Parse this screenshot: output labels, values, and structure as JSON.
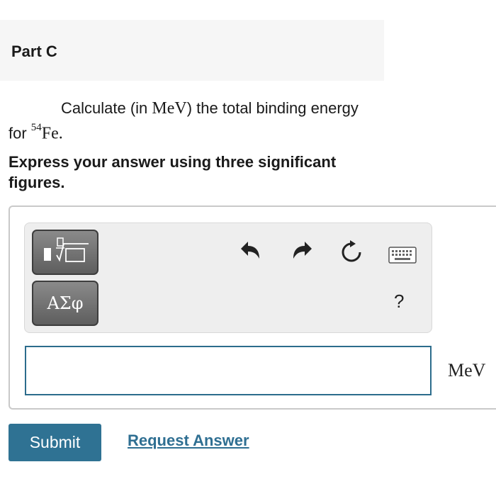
{
  "part": {
    "title": "Part C"
  },
  "question": {
    "text_before": "Calculate (in ",
    "unit_math": "MeV",
    "text_after": ") the total binding energy for ",
    "isotope_mass_number": "54",
    "isotope_symbol": "Fe",
    "period": "."
  },
  "instruction": "Express your answer using three significant figures.",
  "toolbar": {
    "templates_icon": "fraction-root-templates-icon",
    "symbols_label": "ΑΣφ",
    "undo_icon": "undo-icon",
    "redo_icon": "redo-icon",
    "reset_icon": "reset-icon",
    "keyboard_icon": "keyboard-icon",
    "help_label": "?"
  },
  "answer": {
    "value": "",
    "unit": "MeV"
  },
  "actions": {
    "submit_label": "Submit",
    "request_answer_label": "Request Answer"
  },
  "colors": {
    "accent": "#2f7293",
    "link": "#2f6f92",
    "input_border": "#2c6c8c",
    "toolbar_bg": "#eeeeee",
    "button_dark": "#5e5e5e"
  }
}
